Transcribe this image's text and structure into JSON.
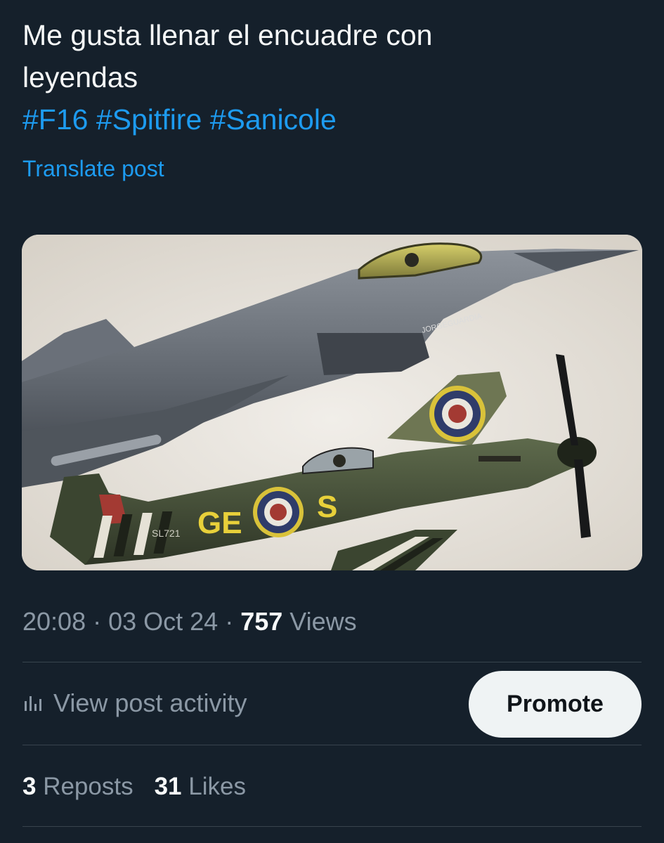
{
  "post": {
    "text_line1": "Me gusta llenar el encuadre con",
    "text_line2": "leyendas",
    "hashtags": [
      "#F16",
      "#Spitfire",
      "#Sanicole"
    ],
    "translate_label": "Translate post"
  },
  "media": {
    "description_icon": "photo",
    "watermark": "JORGEGUARDIA",
    "aircraft_codes": {
      "left": "GE",
      "right": "S",
      "serial": "SL721"
    }
  },
  "meta": {
    "time": "20:08",
    "sep1": " · ",
    "date": "03 Oct 24",
    "sep2": " · ",
    "views_count": "757",
    "views_label": " Views"
  },
  "actions": {
    "activity_icon": "bar-chart-icon",
    "view_activity_label": "View post activity",
    "promote_label": "Promote"
  },
  "stats": {
    "reposts_count": "3",
    "reposts_label": " Reposts",
    "likes_count": "31",
    "likes_label": " Likes"
  },
  "colors": {
    "background": "#15202b",
    "accent": "#1d9bf0",
    "text": "#f7f9f9",
    "muted": "#8b98a5",
    "divider": "#38444d",
    "button_bg": "#eff3f4"
  }
}
